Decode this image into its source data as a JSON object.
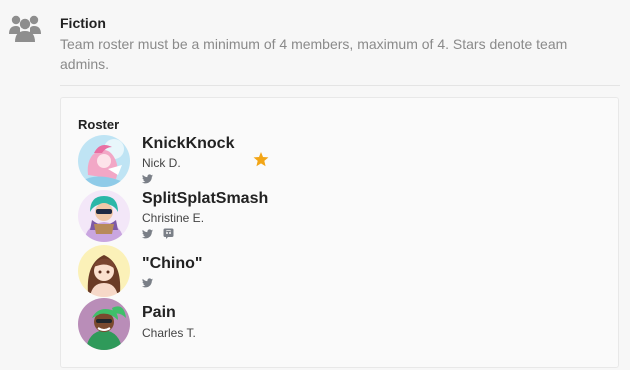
{
  "team": {
    "name": "Fiction",
    "description": "Team roster must be a minimum of 4 members, maximum of 4. Stars denote team admins.",
    "icon": "users-icon"
  },
  "roster": {
    "heading": "Roster",
    "members": [
      {
        "name": "KnickKnock",
        "real_name": "Nick D.",
        "admin": true,
        "socials": [
          "twitter-icon"
        ]
      },
      {
        "name": "SplitSplatSmash",
        "real_name": "Christine E.",
        "admin": false,
        "socials": [
          "twitter-icon",
          "discord-icon"
        ]
      },
      {
        "name": "\"Chino\"",
        "real_name": "",
        "admin": false,
        "socials": [
          "twitter-icon"
        ]
      },
      {
        "name": "Pain",
        "real_name": "Charles T.",
        "admin": false,
        "socials": []
      }
    ]
  },
  "colors": {
    "star": "#f2a516",
    "social": "#7a7f87",
    "muted": "#8a8a8a"
  }
}
